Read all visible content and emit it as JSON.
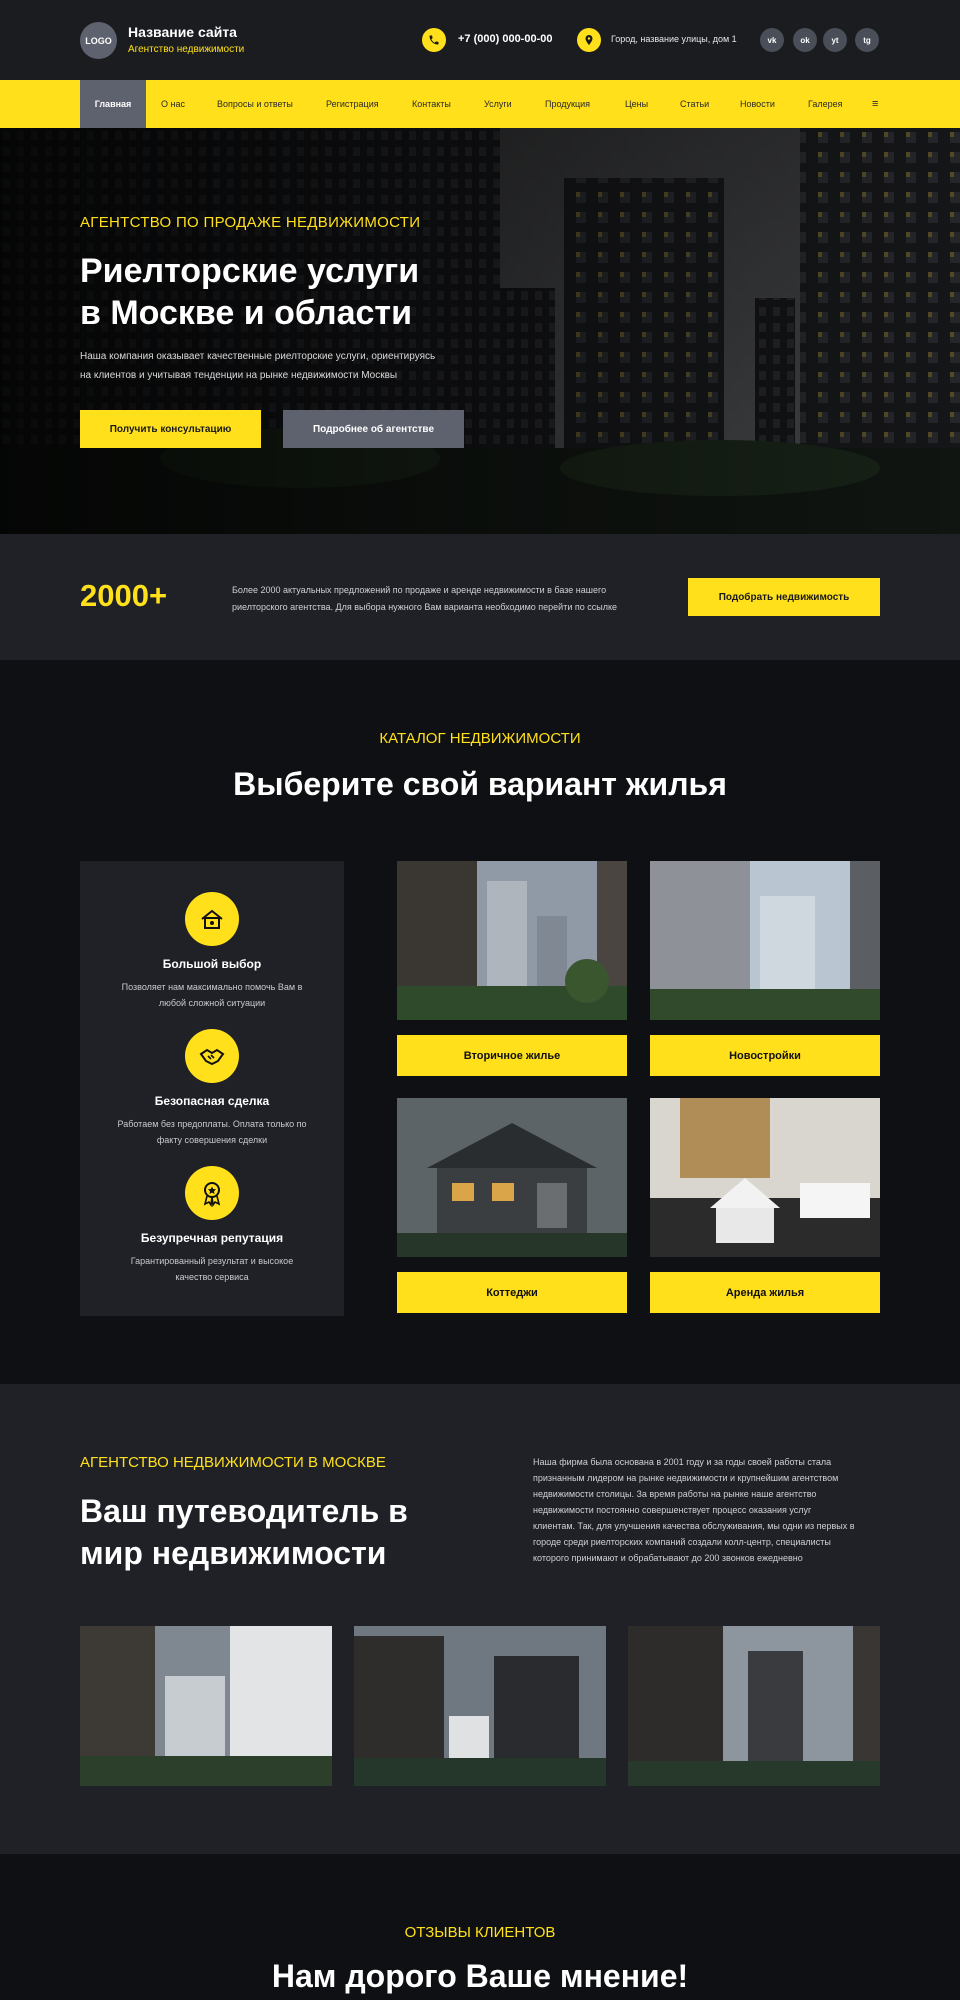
{
  "header": {
    "logo": "LOGO",
    "site_name": "Название сайта",
    "site_subtitle": "Агентство недвижимости",
    "phone": "+7 (000) 000-00-00",
    "address": "Город, название улицы, дом 1",
    "socials": [
      {
        "label": "vk",
        "icon": "vk-icon"
      },
      {
        "label": "ok",
        "icon": "odnoklassniki-icon"
      },
      {
        "label": "yt",
        "icon": "youtube-icon"
      },
      {
        "label": "tg",
        "icon": "telegram-icon"
      }
    ]
  },
  "nav": {
    "items": [
      "Главная",
      "О нас",
      "Вопросы и ответы",
      "Регистрация",
      "Контакты",
      "Услуги",
      "Продукция",
      "Цены",
      "Статьи",
      "Новости",
      "Галерея"
    ],
    "more": "≡"
  },
  "hero": {
    "kicker": "АГЕНТСТВО ПО ПРОДАЖЕ НЕДВИЖИМОСТИ",
    "title_line1": "Риелторские услуги",
    "title_line2": "в Москве и области",
    "text_line1": "Наша компания оказывает качественные риелторские услуги, ориентируясь",
    "text_line2": "на клиентов и учитывая тенденции на рынке недвижимости Москвы",
    "btn_primary": "Получить консультацию",
    "btn_secondary": "Подробнее об агентстве"
  },
  "stat": {
    "number": "2000+",
    "text_line1": "Более 2000 актуальных предложений по продаже и аренде недвижимости в базе нашего",
    "text_line2": "риелторского агентства. Для выбора нужного Вам варианта необходимо перейти по ссылке",
    "button": "Подобрать недвижимость"
  },
  "catalog": {
    "kicker": "КАТАЛОГ НЕДВИЖИМОСТИ",
    "title": "Выберите свой вариант жилья",
    "features": [
      {
        "title": "Большой выбор",
        "desc_line1": "Позволяет нам максимально помочь Вам в",
        "desc_line2": "любой сложной ситуации"
      },
      {
        "title": "Безопасная сделка",
        "desc_line1": "Работаем без предоплаты. Оплата только по",
        "desc_line2": "факту совершения сделки"
      },
      {
        "title": "Безупречная репутация",
        "desc_line1": "Гарантированный результат и высокое",
        "desc_line2": "качество сервиса"
      }
    ],
    "cards": [
      "Вторичное жилье",
      "Новостройки",
      "Коттеджи",
      "Аренда жилья"
    ]
  },
  "about": {
    "kicker": "АГЕНТСТВО НЕДВИЖИМОСТИ В МОСКВЕ",
    "title_line1": "Ваш путеводитель в",
    "title_line2": "мир недвижимости",
    "text": [
      "Наша фирма была основана в 2001 году и за годы своей работы стала",
      "признанным лидером на рынке недвижимости и крупнейшим агентством",
      "недвижимости столицы. За время работы на рынке наше агентство",
      "недвижимости постоянно совершенствует процесс оказания услуг",
      "клиентам. Так, для улучшения качества обслуживания, мы одни из первых в",
      "городе среди риелторских компаний создали колл-центр, специалисты",
      "которого принимают и обрабатывают до 200 звонков ежедневно"
    ]
  },
  "reviews": {
    "kicker": "ОТЗЫВЫ КЛИЕНТОВ",
    "title": "Нам дорого Ваше мнение!"
  },
  "colors": {
    "accent": "#ffe01b",
    "dark": "#0f1013",
    "panel": "#1f2127",
    "gray_button": "#5e626e"
  }
}
